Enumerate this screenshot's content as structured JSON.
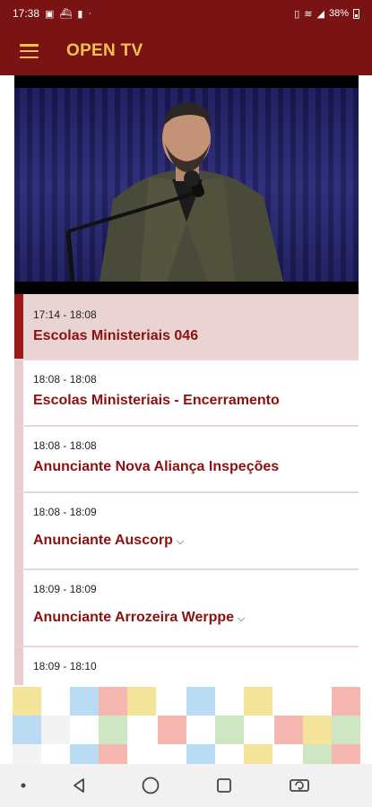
{
  "status_bar": {
    "time": "17:38",
    "battery": "38%",
    "left_icons": [
      "gallery-icon",
      "notification-icon",
      "battery-saver-icon",
      "dot-icon"
    ],
    "right_icons": [
      "vibrate-icon",
      "wifi-icon",
      "signal-icon",
      "battery-icon"
    ]
  },
  "app_bar": {
    "title": "OPEN TV",
    "menu_icon": "hamburger-menu-icon"
  },
  "video": {
    "type": "live-video",
    "subject": "speaker-at-microphone"
  },
  "schedule": [
    {
      "time": "17:14 - 18:08",
      "title": "Escolas Ministeriais 046",
      "active": true,
      "expandable": false
    },
    {
      "time": "18:08 - 18:08",
      "title": "Escolas Ministeriais - Encerramento",
      "active": false,
      "expandable": false
    },
    {
      "time": "18:08 - 18:08",
      "title": "Anunciante Nova Aliança Inspeções",
      "active": false,
      "expandable": false
    },
    {
      "time": "18:08 - 18:09",
      "title": "Anunciante Auscorp",
      "active": false,
      "expandable": true
    },
    {
      "time": "18:09 - 18:09",
      "title": "Anunciante Arrozeira Werppe",
      "active": false,
      "expandable": true
    },
    {
      "time": "18:09 - 18:10",
      "title": "",
      "active": false,
      "expandable": false
    }
  ],
  "colors": {
    "brand": "#7a1414",
    "accent": "#f2c14e",
    "title_text": "#8b1111",
    "active_row": "#ead3d3"
  },
  "nav_bar": {
    "buttons": [
      "dot-icon",
      "back-icon",
      "home-icon",
      "recents-icon",
      "rotate-icon"
    ]
  }
}
